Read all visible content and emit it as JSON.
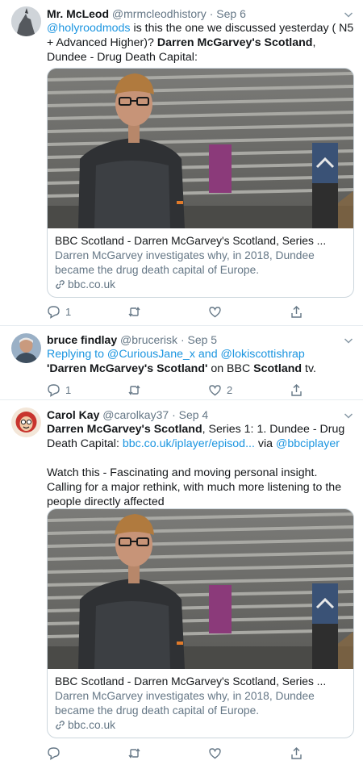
{
  "tweets": [
    {
      "name": "Mr. McLeod",
      "handle": "@mrmcleodhistory",
      "dot": "·",
      "time": "Sep 6",
      "text": {
        "mention": "@holyroodmods",
        "plain1": " is this the one we discussed yesterday ( N5 + Advanced Higher)? ",
        "bold1": "Darren McGarvey's Scotland",
        "plain2": ", Dundee - Drug Death Capital:"
      },
      "card": {
        "title": "BBC Scotland - Darren McGarvey's Scotland, Series ...",
        "description": "Darren McGarvey investigates why, in 2018, Dundee became the drug death capital of Europe.",
        "domain": "bbc.co.uk"
      },
      "reply_count": "1",
      "retweet_count": "",
      "like_count": ""
    },
    {
      "name": "bruce findlay",
      "handle": "@brucerisk",
      "dot": "·",
      "time": "Sep 5",
      "text": {
        "replying_label": "Replying to ",
        "mention1": "@CuriousJane_x",
        "and_label": " and ",
        "mention2": "@lokiscottishrap",
        "bold1": "'Darren McGarvey's Scotland'",
        "plain1": " on BBC ",
        "bold2": "Scotland",
        "plain2": " tv."
      },
      "reply_count": "1",
      "retweet_count": "",
      "like_count": "2"
    },
    {
      "name": "Carol Kay",
      "handle": "@carolkay37",
      "dot": "·",
      "time": "Sep 4",
      "text": {
        "bold1": "Darren McGarvey's Scotland",
        "plain1": ", Series 1: 1. Dundee - Drug Death Capital: ",
        "link1": "bbc.co.uk/iplayer/episod...",
        "plain2": " via ",
        "mention": "@bbciplayer",
        "paragraph2": "Watch this - Fascinating and moving personal insight. Calling for a major rethink, with much more listening to the people directly affected"
      },
      "card": {
        "title": "BBC Scotland - Darren McGarvey's Scotland, Series ...",
        "description": "Darren McGarvey investigates why, in 2018, Dundee became the drug death capital of Europe.",
        "domain": "bbc.co.uk"
      },
      "reply_count": "",
      "retweet_count": "",
      "like_count": ""
    }
  ],
  "colors": {
    "accent": "#1b95e0",
    "secondary_text": "#657786",
    "border": "#e6ecf0"
  },
  "icons": [
    "chevron-down-icon",
    "reply-icon",
    "retweet-icon",
    "like-icon",
    "share-icon",
    "link-icon"
  ]
}
